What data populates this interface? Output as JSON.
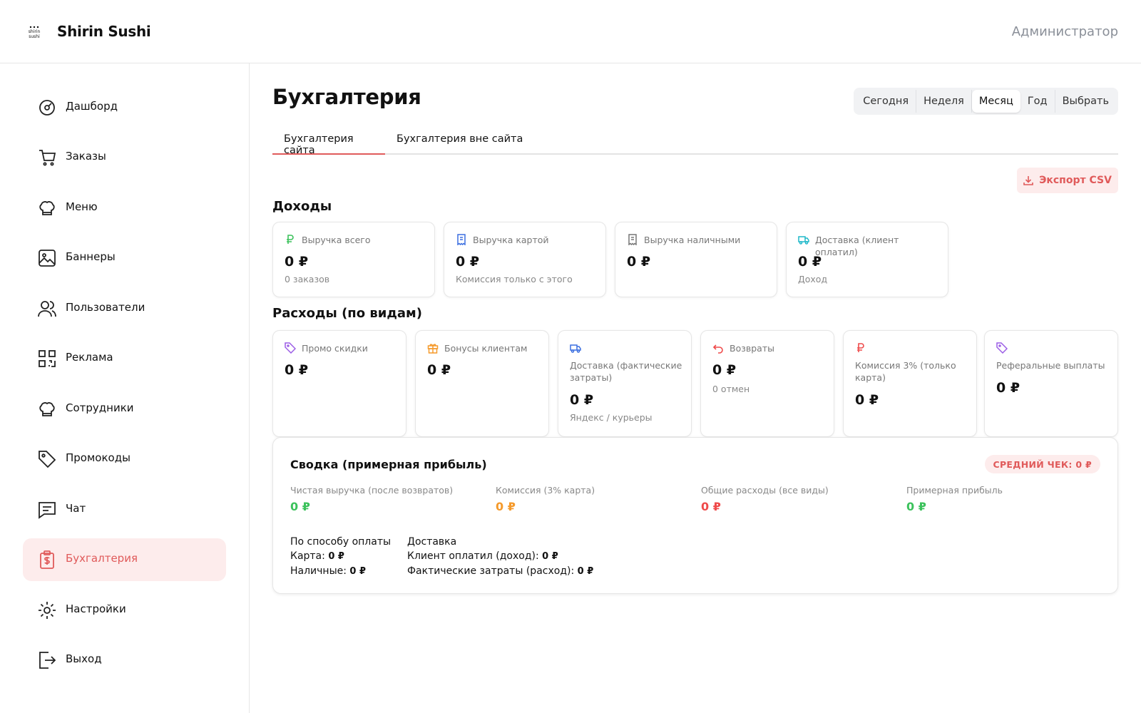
{
  "header": {
    "logo_text": "Shirin sushi",
    "brand": "Shirin Sushi",
    "user_role": "Администратор"
  },
  "sidebar": {
    "items": [
      {
        "label": "Дашборд",
        "icon": "dashboard-icon"
      },
      {
        "label": "Заказы",
        "icon": "cart-icon"
      },
      {
        "label": "Меню",
        "icon": "chef-hat-icon"
      },
      {
        "label": "Баннеры",
        "icon": "image-icon"
      },
      {
        "label": "Пользователи",
        "icon": "users-icon"
      },
      {
        "label": "Реклама",
        "icon": "qr-code-icon"
      },
      {
        "label": "Сотрудники",
        "icon": "chef-hat-icon"
      },
      {
        "label": "Промокоды",
        "icon": "tag-icon"
      },
      {
        "label": "Чат",
        "icon": "chat-icon"
      },
      {
        "label": "Бухгалтерия",
        "icon": "receipt-dollar-icon",
        "active": true
      },
      {
        "label": "Настройки",
        "icon": "gear-icon"
      },
      {
        "label": "Выход",
        "icon": "logout-icon"
      }
    ]
  },
  "page": {
    "title": "Бухгалтерия"
  },
  "periods": {
    "items": [
      "Сегодня",
      "Неделя",
      "Месяц",
      "Год",
      "Выбрать"
    ],
    "selected": "Месяц"
  },
  "tabs": {
    "items": [
      "Бухгалтерия сайта",
      "Бухгалтерия вне сайта"
    ],
    "selected": "Бухгалтерия сайта"
  },
  "export": {
    "label": "Экспорт CSV"
  },
  "income": {
    "title": "Доходы",
    "cards": [
      {
        "label": "Выручка всего",
        "value": "0 ₽",
        "sub": "0 заказов",
        "icon": "ruble-icon",
        "color": "#3cc25c"
      },
      {
        "label": "Выручка картой",
        "value": "0 ₽",
        "sub": "Комиссия только с этого",
        "icon": "receipt-icon",
        "color": "#3b6fe0"
      },
      {
        "label": "Выручка наличными",
        "value": "0 ₽",
        "sub": "",
        "icon": "receipt-icon",
        "color": "#777777"
      },
      {
        "label": "Доставка (клиент оплатил)",
        "value": "0 ₽",
        "sub": "Доход",
        "icon": "truck-icon",
        "color": "#1fb8c9"
      }
    ]
  },
  "expenses": {
    "title": "Расходы (по видам)",
    "cards": [
      {
        "label": "Промо скидки",
        "value": "0 ₽",
        "sub": "",
        "icon": "tag-icon",
        "color": "#9b5de5"
      },
      {
        "label": "Бонусы клиентам",
        "value": "0 ₽",
        "sub": "",
        "icon": "gift-icon",
        "color": "#f59a2b"
      },
      {
        "label": "Доставка (фактические затраты)",
        "value": "0 ₽",
        "sub": "Яндекс / курьеры",
        "icon": "truck-icon",
        "color": "#3b6fe0"
      },
      {
        "label": "Возвраты",
        "value": "0 ₽",
        "sub": "0 отмен",
        "icon": "undo-icon",
        "color": "#ef4b4b"
      },
      {
        "label": "Комиссия 3% (только карта)",
        "value": "0 ₽",
        "sub": "",
        "icon": "ruble-icon",
        "color": "#ef4b4b"
      },
      {
        "label": "Реферальные выплаты",
        "value": "0 ₽",
        "sub": "",
        "icon": "tag-icon",
        "color": "#9b5de5"
      }
    ]
  },
  "summary": {
    "title": "Сводка (примерная прибыль)",
    "avg_check": "СРЕДНИЙ ЧЕК: 0 ₽",
    "metrics": [
      {
        "label": "Чистая выручка (после возвратов)",
        "value": "0 ₽",
        "color": "#3cc25c"
      },
      {
        "label": "Комиссия (3% карта)",
        "value": "0 ₽",
        "color": "#f59a2b"
      },
      {
        "label": "Общие расходы (все виды)",
        "value": "0 ₽",
        "color": "#ef4b4b"
      },
      {
        "label": "Примерная прибыль",
        "value": "0 ₽",
        "color": "#3cc25c"
      }
    ],
    "payment": {
      "title": "По способу оплаты",
      "card_label": "Карта:",
      "card_value": "0 ₽",
      "cash_label": "Наличные:",
      "cash_value": "0 ₽"
    },
    "delivery": {
      "title": "Доставка",
      "client_label": "Клиент оплатил (доход):",
      "client_value": "0 ₽",
      "actual_label": "Фактические затраты (расход):",
      "actual_value": "0 ₽"
    }
  }
}
